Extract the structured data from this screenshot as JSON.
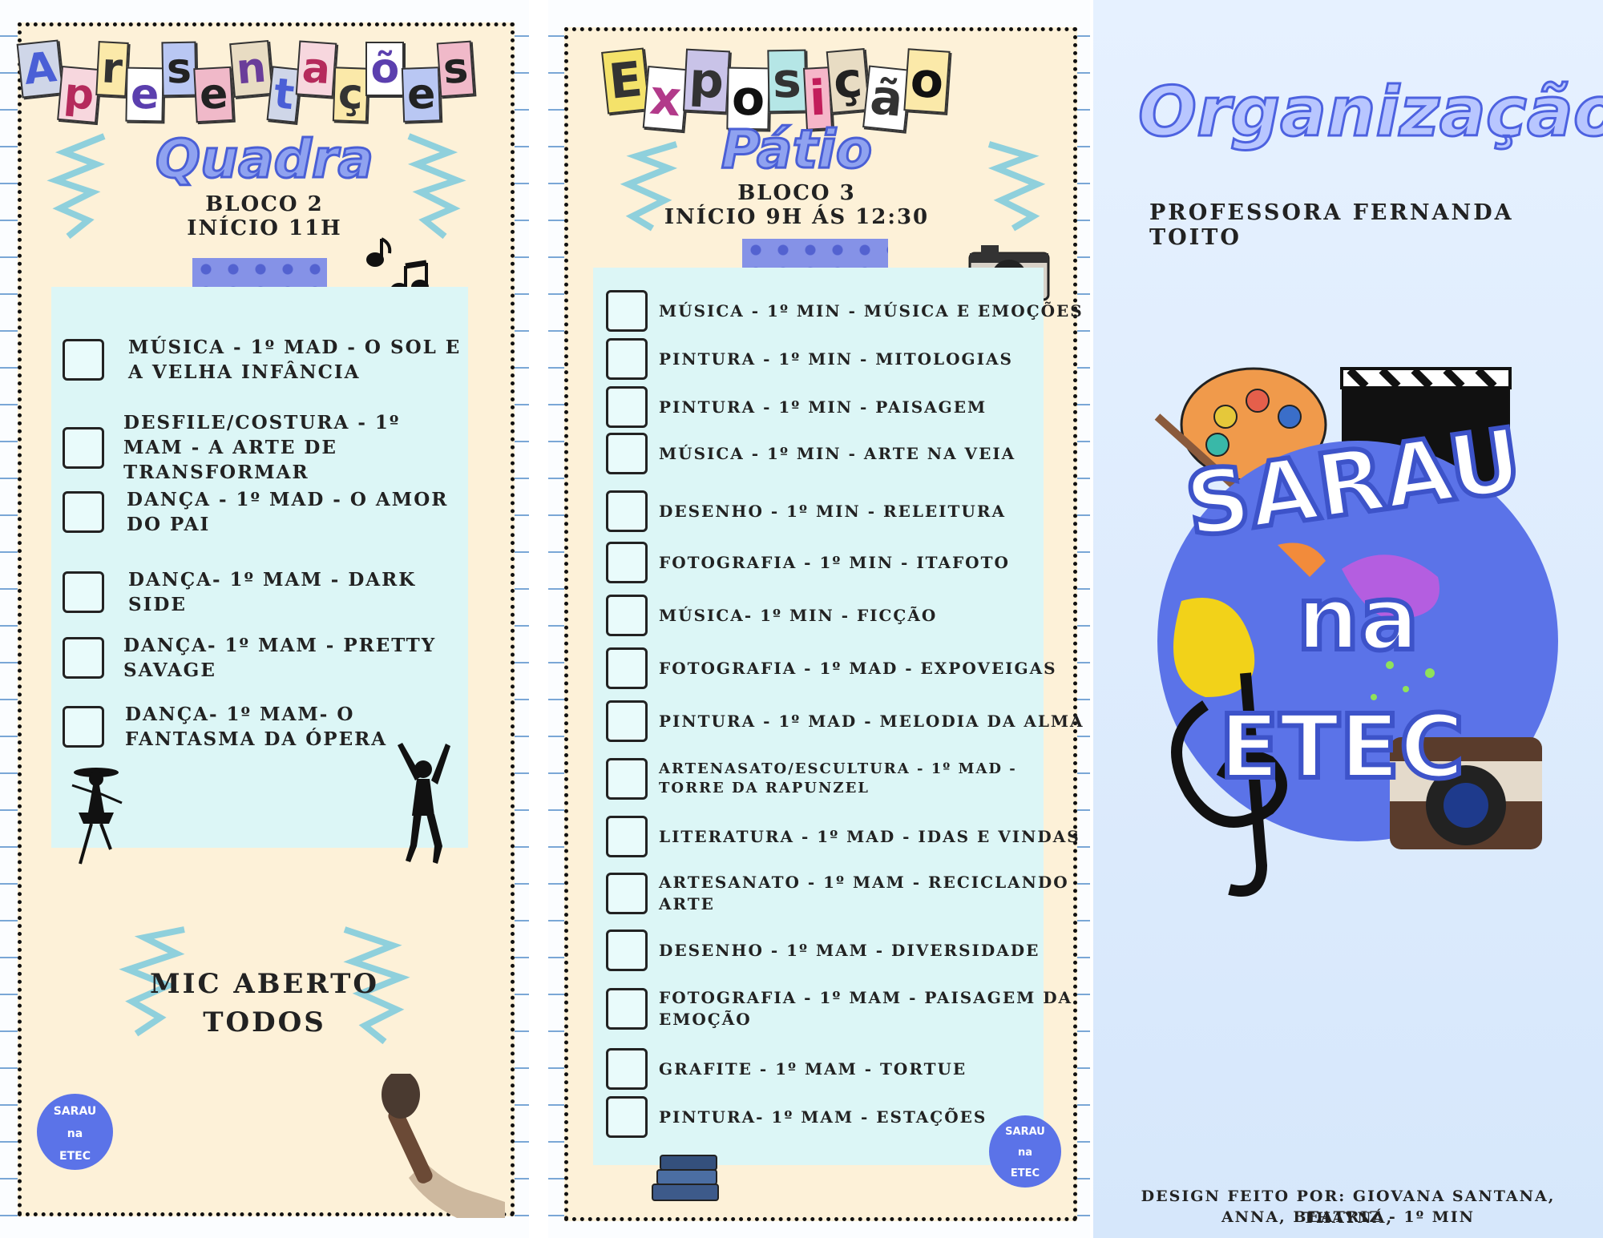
{
  "colors": {
    "accent": "#4a5fd6",
    "cream": "#fdf1d8",
    "mint": "#dcf6f6",
    "tape": "#7f8de8"
  },
  "left": {
    "banner": "Apresentações",
    "subtitle": "Quadra",
    "block": "BLOCO 2",
    "start": "INÍCIO 11H",
    "items": [
      {
        "label": "MÚSICA - 1º MAD - O SOL E A VELHA INFÂNCIA"
      },
      {
        "label": "DESFILE/COSTURA -  1º MAM - A ARTE DE TRANSFORMAR"
      },
      {
        "label": "DANÇA - 1º MAD - O AMOR DO PAI"
      },
      {
        "label": "DANÇA- 1º MAM - DARK SIDE"
      },
      {
        "label": "DANÇA- 1º MAM - PRETTY SAVAGE"
      },
      {
        "label": "DANÇA- 1º MAM- O FANTASMA DA ÓPERA"
      }
    ],
    "mic_line1": "MIC ABERTO",
    "mic_line2": "TODOS",
    "icons": [
      "music-notes-icon",
      "dancer-icon",
      "ballerina-icon",
      "microphone-icon",
      "sarau-logo-icon"
    ]
  },
  "middle": {
    "banner": "Exposição",
    "subtitle": "Pátio",
    "block": "BLOCO 3",
    "start": "INÍCIO 9H ÁS 12:30",
    "items": [
      {
        "label": "MÚSICA - 1º MIN - MÚSICA E EMOÇÕES"
      },
      {
        "label": "PINTURA - 1º MIN - MITOLOGIAS"
      },
      {
        "label": "PINTURA - 1º MIN - PAISAGEM"
      },
      {
        "label": "MÚSICA - 1º MIN - ARTE NA VEIA"
      },
      {
        "label": "DESENHO - 1º MIN - RELEITURA"
      },
      {
        "label": "FOTOGRAFIA - 1º MIN - ITAFOTO"
      },
      {
        "label": "MÚSICA- 1º MIN - FICÇÃO"
      },
      {
        "label": "FOTOGRAFIA - 1º MAD - EXPOVEIGAS"
      },
      {
        "label": "PINTURA - 1º MAD - MELODIA DA ALMA"
      },
      {
        "label": "ARTENASATO/ESCULTURA - 1º MAD - TORRE DA RAPUNZEL"
      },
      {
        "label": "LITERATURA - 1º MAD - IDAS E VINDAS"
      },
      {
        "label": "ARTESANATO - 1º MAM - RECICLANDO ARTE"
      },
      {
        "label": "DESENHO - 1º MAM - DIVERSIDADE"
      },
      {
        "label": "FOTOGRAFIA - 1º MAM - PAISAGEM DA EMOÇÃO"
      },
      {
        "label": "GRAFITE - 1º MAM - TORTUE"
      },
      {
        "label": "PINTURA- 1º MAM - ESTAÇÕES"
      }
    ],
    "icons": [
      "camera-icon",
      "books-icon",
      "sarau-logo-icon"
    ]
  },
  "right": {
    "title": "Organização:",
    "organizer": "PROFESSORA FERNANDA TOITO",
    "logo_line1": "SARAU",
    "logo_line2": "na",
    "logo_line3": "ETEC",
    "credit_line1": "DESIGN FEITO POR: GIOVANA SANTANA, THAYNÁ,",
    "credit_line2": "ANNA, BEATRIZ - 1º MIN",
    "icons": [
      "palette-icon",
      "clapperboard-icon",
      "treble-clef-icon",
      "camera-icon",
      "paint-splash-icon"
    ]
  }
}
